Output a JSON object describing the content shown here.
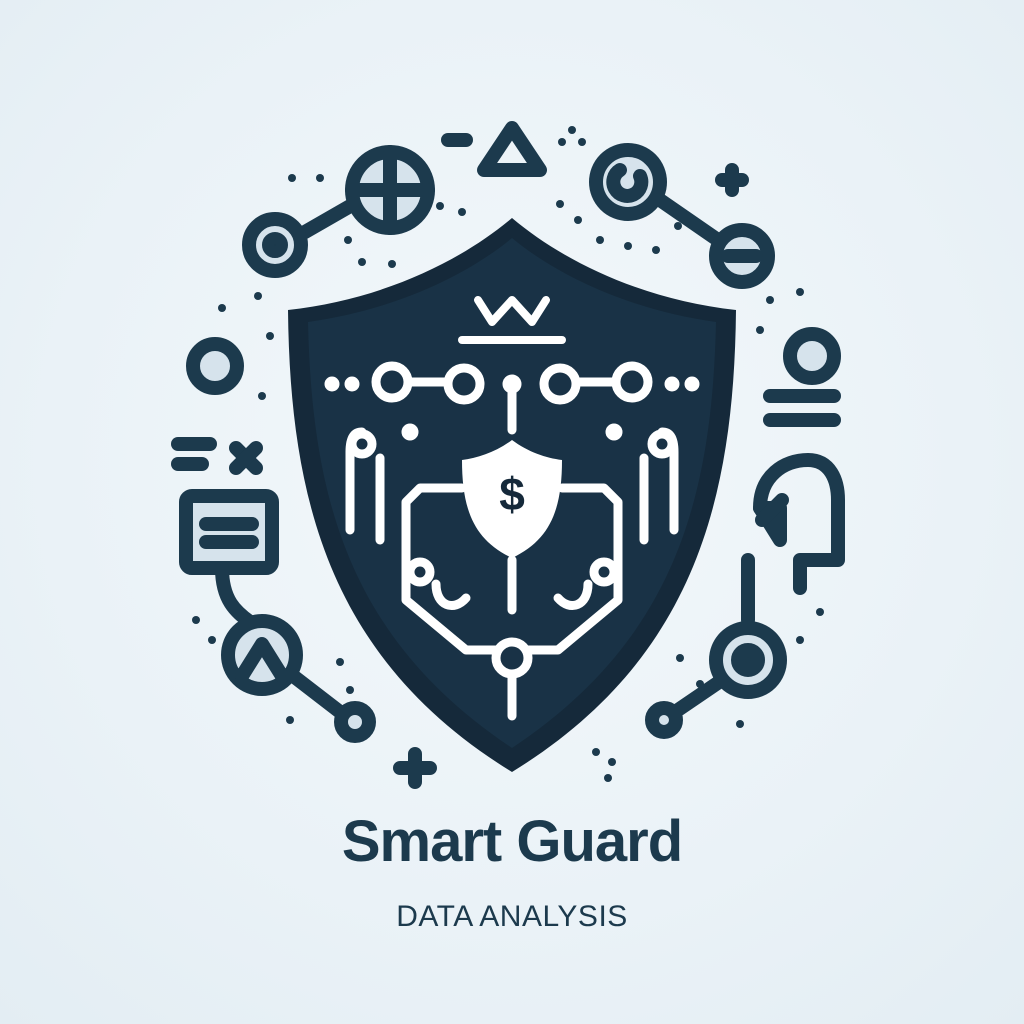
{
  "brand": {
    "title": "Smart Guard",
    "subtitle": "DATA ANALYSIS"
  },
  "emblem": {
    "shield_symbol": "$"
  },
  "icons": [
    "shield-icon",
    "dollar-icon",
    "crown-icon",
    "circuit-icon",
    "crosshair-icon",
    "triangle-icon",
    "target-icon",
    "minus-circle-icon",
    "plus-icon",
    "person-icon",
    "profile-head-icon",
    "document-icon",
    "close-icon",
    "chart-node-icon"
  ],
  "colors": {
    "primary": "#1c3a4d",
    "shield_dark": "#15293a",
    "accent_fill": "#d6e3ec",
    "background": "#eaf2f7",
    "line_white": "#ffffff"
  }
}
